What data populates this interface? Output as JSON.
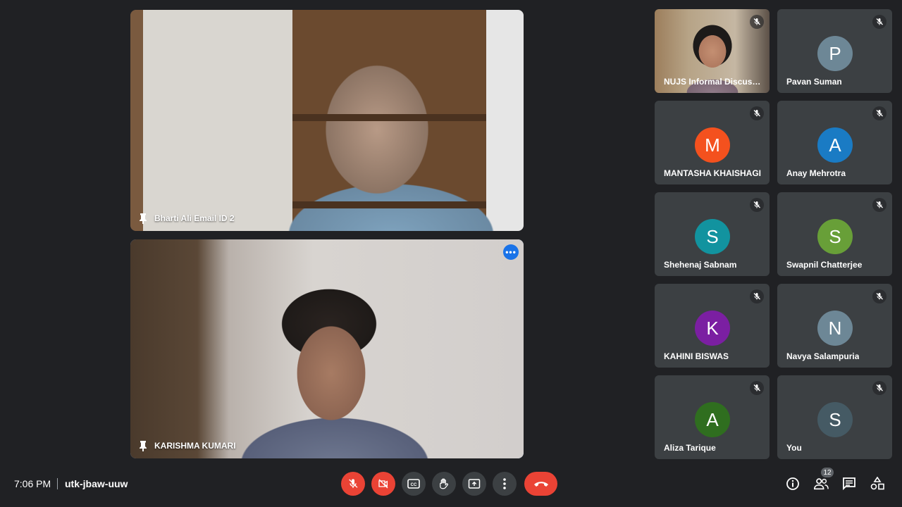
{
  "main_tiles": [
    {
      "name": "Bharti Ali Email ID 2"
    },
    {
      "name": "KARISHMA KUMARI",
      "more_options": "•••"
    }
  ],
  "participants": [
    {
      "name": "NUJS Informal Discussi...",
      "initial": "",
      "video": true
    },
    {
      "name": "Pavan Suman",
      "initial": "P",
      "color": "#6d8796"
    },
    {
      "name": "MANTASHA KHAISHAGI",
      "initial": "M",
      "color": "#f4511e"
    },
    {
      "name": "Anay Mehrotra",
      "initial": "A",
      "color": "#1a7bc4"
    },
    {
      "name": "Shehenaj Sabnam",
      "initial": "S",
      "color": "#12939f"
    },
    {
      "name": "Swapnil Chatterjee",
      "initial": "S",
      "color": "#689f38"
    },
    {
      "name": "KAHINI BISWAS",
      "initial": "K",
      "color": "#7b1fa2"
    },
    {
      "name": "Navya Salampuria",
      "initial": "N",
      "color": "#6d8796"
    },
    {
      "name": "Aliza Tarique",
      "initial": "A",
      "color": "#2f6e1f"
    },
    {
      "name": "You",
      "initial": "S",
      "color": "#455a64"
    }
  ],
  "bottom_bar": {
    "time": "7:06 PM",
    "meeting_code": "utk-jbaw-uuw",
    "people_count": "12"
  }
}
